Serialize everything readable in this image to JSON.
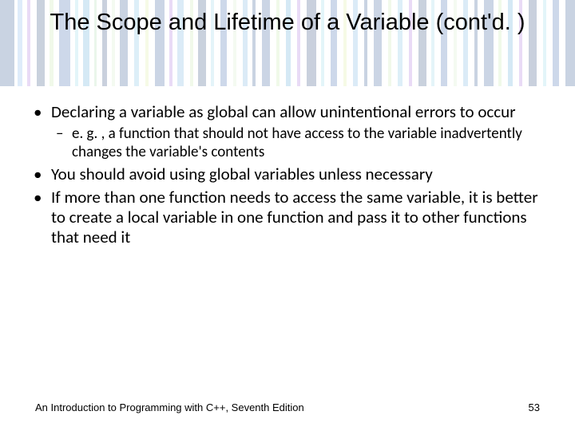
{
  "title": "The Scope and Lifetime of a Variable (cont'd. )",
  "bullets": [
    {
      "text": "Declaring a variable as global can allow unintentional errors to occur",
      "sub": [
        "e. g. , a function that should not have access to the variable inadvertently changes the variable's contents"
      ]
    },
    {
      "text": "You should avoid using global variables unless necessary",
      "sub": []
    },
    {
      "text": "If more than one function needs to access the same variable, it is better to create a local variable in one function and pass it to other functions that need it",
      "sub": []
    }
  ],
  "footer": {
    "left": "An Introduction to Programming with C++, Seventh Edition",
    "right": "53"
  }
}
